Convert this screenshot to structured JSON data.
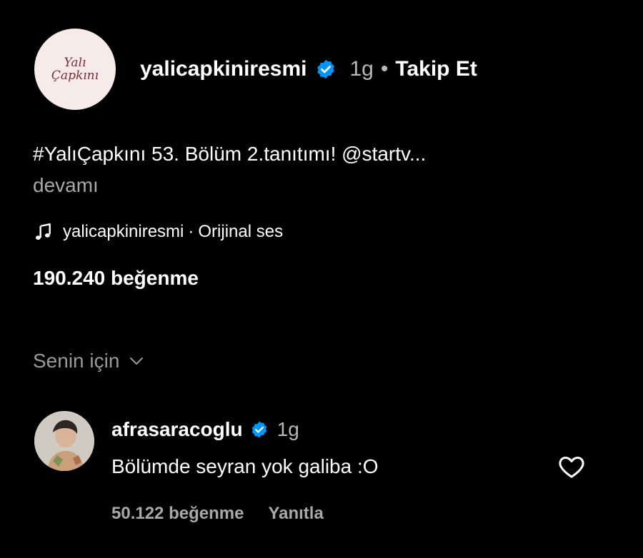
{
  "post": {
    "username": "yalicapkiniresmi",
    "time_ago": "1g",
    "separator": "•",
    "follow_label": "Takip Et",
    "logo_line1": "Yalı",
    "logo_line2": "Çapkını",
    "caption": "#YalıÇapkını 53. Bölüm 2.tanıtımı! @startv...",
    "more_label": "devamı",
    "audio_user": "yalicapkiniresmi",
    "audio_separator": "·",
    "audio_title": "Orijinal ses",
    "likes": "190.240 beğenme"
  },
  "sort": {
    "label": "Senin için"
  },
  "comment": {
    "username": "afrasaracoglu",
    "time_ago": "1g",
    "text": "Bölümde seyran yok galiba :O",
    "likes": "50.122 beğenme",
    "reply_label": "Yanıtla"
  },
  "colors": {
    "background": "#000000",
    "verified": "#0095f6",
    "muted_text": "#a8a8a8"
  },
  "icons": [
    "verified-badge-icon",
    "music-note-icon",
    "chevron-down-icon",
    "heart-outline-icon"
  ]
}
